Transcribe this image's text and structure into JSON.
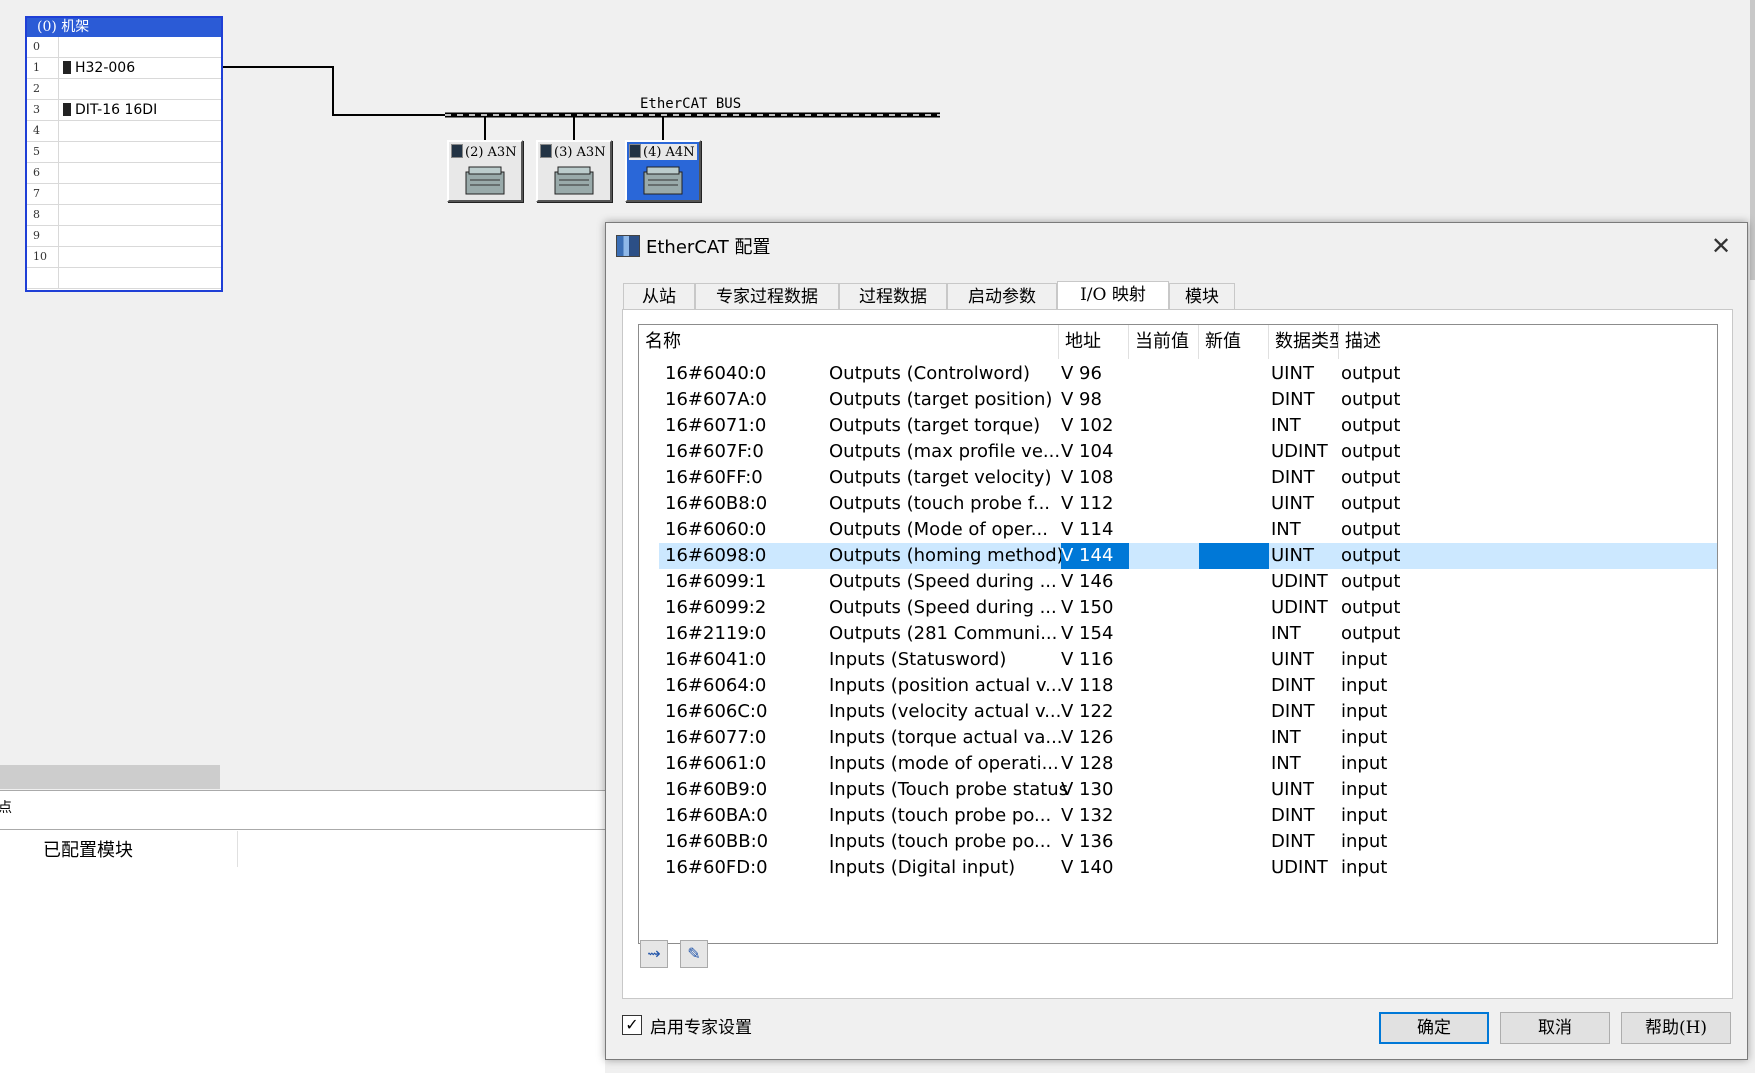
{
  "rack": {
    "title": "(0) 机架",
    "slots": [
      {
        "num": "0",
        "module": ""
      },
      {
        "num": "1",
        "module": "H32-006"
      },
      {
        "num": "2",
        "module": ""
      },
      {
        "num": "3",
        "module": "DIT-16 16DI"
      },
      {
        "num": "4",
        "module": ""
      },
      {
        "num": "5",
        "module": ""
      },
      {
        "num": "6",
        "module": ""
      },
      {
        "num": "7",
        "module": ""
      },
      {
        "num": "8",
        "module": ""
      },
      {
        "num": "9",
        "module": ""
      },
      {
        "num": "10",
        "module": ""
      },
      {
        "num": "",
        "module": ""
      }
    ]
  },
  "bus": {
    "label": "EtherCAT BUS",
    "devices": [
      {
        "label": "(2) A3N",
        "selected": false
      },
      {
        "label": "(3) A3N",
        "selected": false
      },
      {
        "label": "(4) A4N",
        "selected": true
      }
    ]
  },
  "lower": {
    "header_glyph": "点",
    "configured_modules": "已配置模块"
  },
  "dialog": {
    "title": "EtherCAT 配置",
    "close_glyph": "✕",
    "tabs": [
      "从站",
      "专家过程数据",
      "过程数据",
      "启动参数",
      "I/O 映射",
      "模块"
    ],
    "active_tab": 4,
    "columns": [
      "名称",
      "地址",
      "当前值",
      "新值",
      "数据类型",
      "描述"
    ],
    "rows": [
      {
        "index": "16#6040:0",
        "name": "Outputs (Controlword)",
        "addr": "V 96",
        "cur": "",
        "new": "",
        "type": "UINT",
        "desc": "output"
      },
      {
        "index": "16#607A:0",
        "name": "Outputs (target position)",
        "addr": "V 98",
        "cur": "",
        "new": "",
        "type": "DINT",
        "desc": "output"
      },
      {
        "index": "16#6071:0",
        "name": "Outputs (target torque)",
        "addr": "V 102",
        "cur": "",
        "new": "",
        "type": "INT",
        "desc": "output"
      },
      {
        "index": "16#607F:0",
        "name": "Outputs (max profile ve...",
        "addr": "V 104",
        "cur": "",
        "new": "",
        "type": "UDINT",
        "desc": "output"
      },
      {
        "index": "16#60FF:0",
        "name": "Outputs (target velocity)",
        "addr": "V 108",
        "cur": "",
        "new": "",
        "type": "DINT",
        "desc": "output"
      },
      {
        "index": "16#60B8:0",
        "name": "Outputs (touch probe f...",
        "addr": "V 112",
        "cur": "",
        "new": "",
        "type": "UINT",
        "desc": "output"
      },
      {
        "index": "16#6060:0",
        "name": "Outputs (Mode of oper...",
        "addr": "V 114",
        "cur": "",
        "new": "",
        "type": "INT",
        "desc": "output"
      },
      {
        "index": "16#6098:0",
        "name": "Outputs (homing method)",
        "addr": "V 144",
        "cur": "",
        "new": "",
        "type": "UINT",
        "desc": "output"
      },
      {
        "index": "16#6099:1",
        "name": "Outputs (Speed during ...",
        "addr": "V 146",
        "cur": "",
        "new": "",
        "type": "UDINT",
        "desc": "output"
      },
      {
        "index": "16#6099:2",
        "name": "Outputs (Speed during ...",
        "addr": "V 150",
        "cur": "",
        "new": "",
        "type": "UDINT",
        "desc": "output"
      },
      {
        "index": "16#2119:0",
        "name": "Outputs (281 Communi...",
        "addr": "V 154",
        "cur": "",
        "new": "",
        "type": "INT",
        "desc": "output"
      },
      {
        "index": "16#6041:0",
        "name": "Inputs (Statusword)",
        "addr": "V 116",
        "cur": "",
        "new": "",
        "type": "UINT",
        "desc": "input"
      },
      {
        "index": "16#6064:0",
        "name": "Inputs (position actual v...",
        "addr": "V 118",
        "cur": "",
        "new": "",
        "type": "DINT",
        "desc": "input"
      },
      {
        "index": "16#606C:0",
        "name": "Inputs (velocity actual v...",
        "addr": "V 122",
        "cur": "",
        "new": "",
        "type": "DINT",
        "desc": "input"
      },
      {
        "index": "16#6077:0",
        "name": "Inputs (torque actual va...",
        "addr": "V 126",
        "cur": "",
        "new": "",
        "type": "INT",
        "desc": "input"
      },
      {
        "index": "16#6061:0",
        "name": "Inputs (mode of operati...",
        "addr": "V 128",
        "cur": "",
        "new": "",
        "type": "INT",
        "desc": "input"
      },
      {
        "index": "16#60B9:0",
        "name": "Inputs (Touch probe status)",
        "addr": "V 130",
        "cur": "",
        "new": "",
        "type": "UINT",
        "desc": "input"
      },
      {
        "index": "16#60BA:0",
        "name": "Inputs (touch probe po...",
        "addr": "V 132",
        "cur": "",
        "new": "",
        "type": "DINT",
        "desc": "input"
      },
      {
        "index": "16#60BB:0",
        "name": "Inputs (touch probe po...",
        "addr": "V 136",
        "cur": "",
        "new": "",
        "type": "DINT",
        "desc": "input"
      },
      {
        "index": "16#60FD:0",
        "name": "Inputs (Digital input)",
        "addr": "V 140",
        "cur": "",
        "new": "",
        "type": "UDINT",
        "desc": "input"
      }
    ],
    "selected_row": 7,
    "tool_icons": [
      "link-icon",
      "edit-icon"
    ],
    "expert_label": "启用专家设置",
    "expert_checked": true,
    "buttons": {
      "ok": "确定",
      "cancel": "取消",
      "help": "帮助(H)"
    }
  },
  "colors": {
    "rack_border": "#1f3fd6",
    "rack_title_bg": "#2b5bd6",
    "selected_device": "#2a67d8",
    "row_highlight": "#cce8ff",
    "cell_highlight": "#0078d7"
  }
}
